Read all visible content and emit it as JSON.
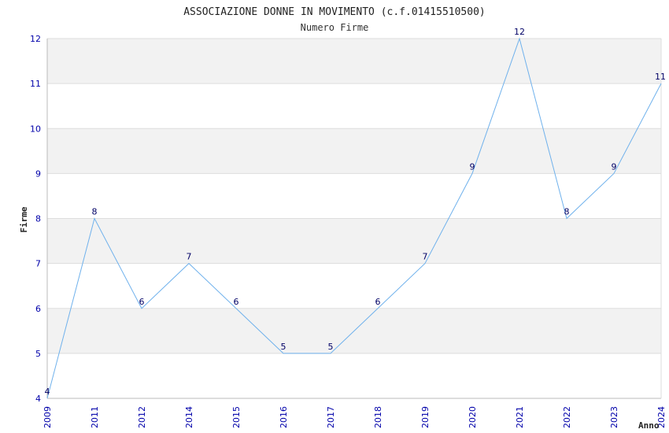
{
  "chart_data": {
    "type": "line",
    "title": "ASSOCIAZIONE DONNE IN MOVIMENTO (c.f.01415510500)",
    "subtitle": "Numero Firme",
    "xlabel": "Anno",
    "ylabel": "Firme",
    "x": [
      "2009",
      "2011",
      "2012",
      "2014",
      "2015",
      "2016",
      "2017",
      "2018",
      "2019",
      "2020",
      "2021",
      "2022",
      "2023",
      "2024"
    ],
    "series": [
      {
        "values": [
          4,
          8,
          6,
          7,
          6,
          5,
          5,
          6,
          7,
          9,
          12,
          8,
          9,
          11
        ]
      }
    ],
    "ylim": [
      4,
      12
    ],
    "yticks": [
      4,
      5,
      6,
      7,
      8,
      9,
      10,
      11,
      12
    ],
    "grid": "horizontal alternating bands",
    "colors": {
      "line": "#6fb1ec",
      "band": "#f2f2f2",
      "gridline": "#dddddd",
      "tick_text": "#0000aa",
      "label_text": "#000066"
    }
  }
}
